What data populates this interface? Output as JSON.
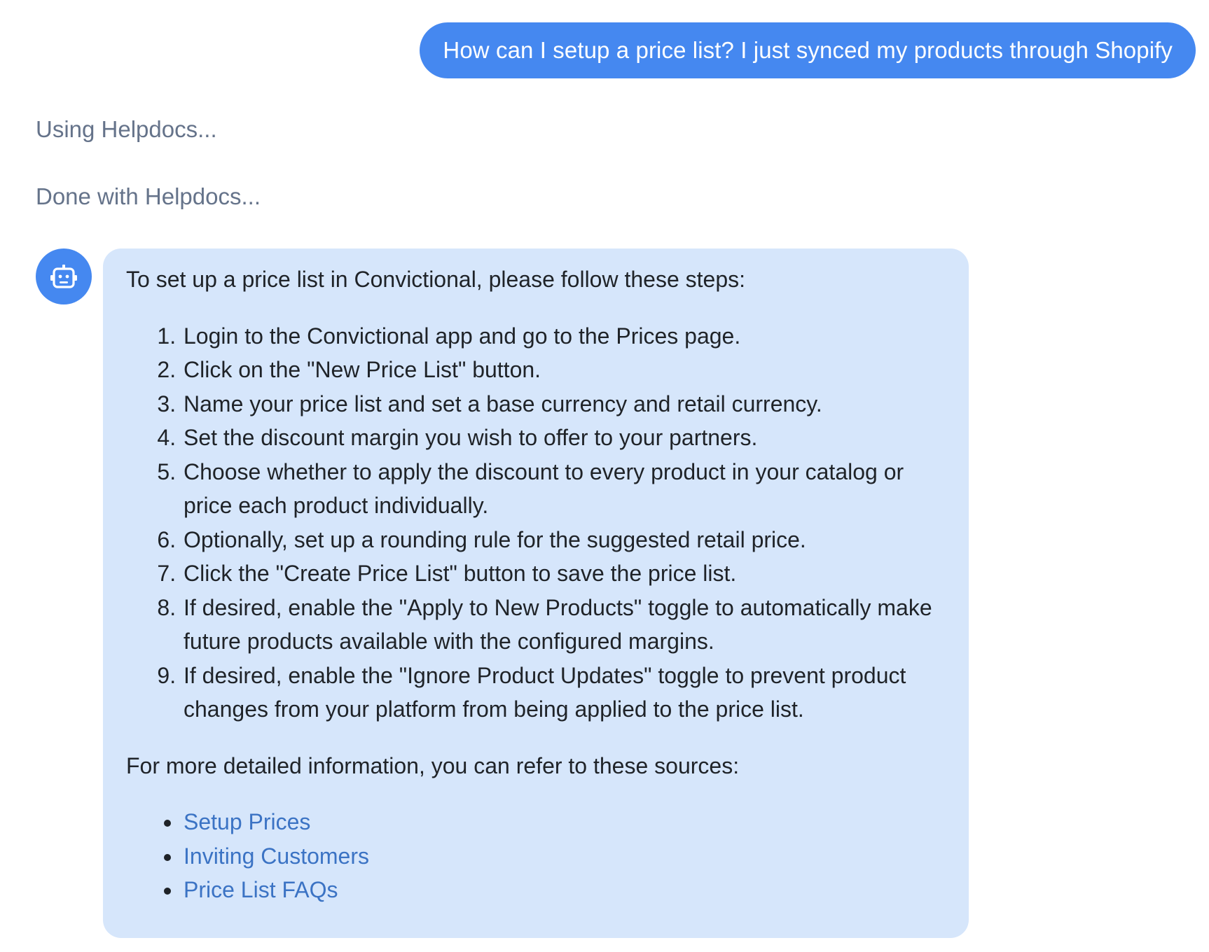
{
  "user_message": {
    "text": "How can I setup a price list? I just synced my products through Shopify"
  },
  "status_lines": [
    "Using Helpdocs...",
    "Done with Helpdocs..."
  ],
  "bot": {
    "avatar_icon": "robot-icon",
    "intro": "To set up a price list in Convictional, please follow these steps:",
    "steps": [
      "Login to the Convictional app and go to the Prices page.",
      "Click on the \"New Price List\" button.",
      "Name your price list and set a base currency and retail currency.",
      "Set the discount margin you wish to offer to your partners.",
      "Choose whether to apply the discount to every product in your catalog or price each product individually.",
      "Optionally, set up a rounding rule for the suggested retail price.",
      "Click the \"Create Price List\" button to save the price list.",
      "If desired, enable the \"Apply to New Products\" toggle to automatically make future products available with the configured margins.",
      "If desired, enable the \"Ignore Product Updates\" toggle to prevent product changes from your platform from being applied to the price list."
    ],
    "sources_intro": "For more detailed information, you can refer to these sources:",
    "sources": [
      "Setup Prices",
      "Inviting Customers",
      "Price List FAQs"
    ]
  },
  "colors": {
    "user_bubble": "#4588f0",
    "bot_bubble": "#d6e6fb",
    "link": "#3b73c4",
    "status_text": "#65738a"
  }
}
